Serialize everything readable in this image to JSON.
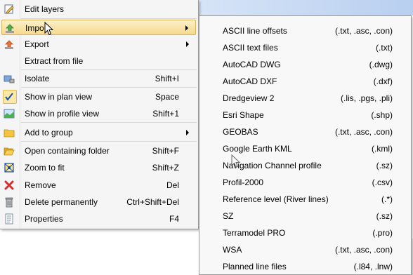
{
  "context_menu": {
    "items": [
      {
        "id": "edit-layers",
        "label": "Edit layers",
        "shortcut": "",
        "icon": "edit-layers-icon"
      },
      {
        "id": "import",
        "label": "Impo",
        "shortcut": "",
        "icon": "import-icon",
        "submenu": true
      },
      {
        "id": "export",
        "label": "Export",
        "shortcut": "",
        "icon": "export-icon",
        "submenu": true
      },
      {
        "id": "extract-from-file",
        "label": "Extract from file",
        "shortcut": "",
        "icon": ""
      },
      {
        "id": "isolate",
        "label": "Isolate",
        "shortcut": "Shift+I",
        "icon": "isolate-icon"
      },
      {
        "id": "show-in-plan-view",
        "label": "Show in plan view",
        "shortcut": "Space",
        "icon": "checkmark-icon",
        "checked": true
      },
      {
        "id": "show-in-profile-view",
        "label": "Show in profile view",
        "shortcut": "Shift+1",
        "icon": "profile-view-icon"
      },
      {
        "id": "add-to-group",
        "label": "Add to group",
        "shortcut": "",
        "icon": "folder-icon",
        "submenu": true
      },
      {
        "id": "open-containing-folder",
        "label": "Open containing folder",
        "shortcut": "Shift+F",
        "icon": "open-folder-icon"
      },
      {
        "id": "zoom-to-fit",
        "label": "Zoom to fit",
        "shortcut": "Shift+Z",
        "icon": "zoom-to-fit-icon"
      },
      {
        "id": "remove",
        "label": "Remove",
        "shortcut": "Del",
        "icon": "remove-x-icon"
      },
      {
        "id": "delete-permanently",
        "label": "Delete permanently",
        "shortcut": "Ctrl+Shift+Del",
        "icon": "trash-icon"
      },
      {
        "id": "properties",
        "label": "Properties",
        "shortcut": "F4",
        "icon": "properties-icon"
      }
    ]
  },
  "import_submenu": {
    "items": [
      {
        "label": "ASCII line offsets",
        "ext": "(.txt, .asc, .con)"
      },
      {
        "label": "ASCII text files",
        "ext": "(.txt)"
      },
      {
        "label": "AutoCAD DWG",
        "ext": "(.dwg)"
      },
      {
        "label": "AutoCAD DXF",
        "ext": "(.dxf)"
      },
      {
        "label": "Dredgeview 2",
        "ext": "(.lis, .pgs, .pli)"
      },
      {
        "label": "Esri Shape",
        "ext": "(.shp)"
      },
      {
        "label": "GEOBAS",
        "ext": "(.txt, .asc, .con)"
      },
      {
        "label": "Google Earth KML",
        "ext": "(.kml)"
      },
      {
        "label": "Navigation Channel profile",
        "ext": "(.sz)"
      },
      {
        "label": "Profil-2000",
        "ext": "(.csv)"
      },
      {
        "label": "Reference level (River lines)",
        "ext": "(.*)"
      },
      {
        "label": "SZ",
        "ext": "(.sz)"
      },
      {
        "label": "Terramodel PRO",
        "ext": "(.pro)"
      },
      {
        "label": "WSA",
        "ext": "(.txt, .asc, .con)"
      },
      {
        "label": "Planned line files",
        "ext": "(.l84, .lnw)"
      }
    ]
  },
  "colors": {
    "highlight": "#f6d98c",
    "menu_bg": "#f5f5f5"
  }
}
